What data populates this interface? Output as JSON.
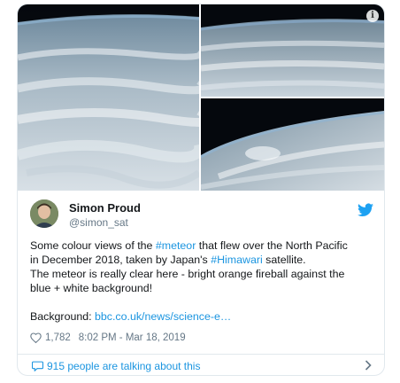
{
  "tweet": {
    "author": {
      "display_name": "Simon Proud",
      "handle": "@simon_sat"
    },
    "text": {
      "line1_pre": "Some colour views of the ",
      "line1_tag": "#meteor",
      "line1_post": " that flew over the North Pacific",
      "line2_pre": "in December 2018, taken by Japan's ",
      "line2_tag": "#Himawari",
      "line2_post": " satellite.",
      "line3": "The meteor is really clear here - bright orange fireball against the",
      "line4": "blue + white background!",
      "background_label": "Background: ",
      "background_link": "bbc.co.uk/news/science-e…"
    },
    "likes": "1,782",
    "timestamp": "8:02 PM - Mar 18, 2019",
    "talking": "915 people are talking about this",
    "info_glyph": "i",
    "icons": [
      "info-icon",
      "twitter-bird-icon",
      "heart-icon",
      "speech-bubble-icon",
      "chevron-right-icon"
    ],
    "colors": {
      "link": "#1b95e0",
      "meta": "#657786",
      "border": "#e1e8ed"
    }
  }
}
